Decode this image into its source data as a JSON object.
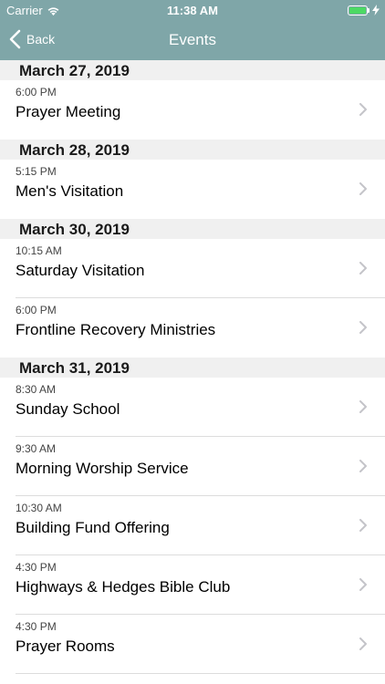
{
  "status_bar": {
    "carrier": "Carrier",
    "time": "11:38 AM"
  },
  "nav": {
    "back_label": "Back",
    "title": "Events"
  },
  "colors": {
    "header_bg": "#7fa6a8",
    "battery": "#4cd964"
  },
  "sections": [
    {
      "date": "March 27, 2019",
      "events": [
        {
          "time": "6:00 PM",
          "title": "Prayer Meeting"
        }
      ]
    },
    {
      "date": "March 28, 2019",
      "events": [
        {
          "time": "5:15 PM",
          "title": "Men's Visitation"
        }
      ]
    },
    {
      "date": "March 30, 2019",
      "events": [
        {
          "time": "10:15 AM",
          "title": "Saturday Visitation"
        },
        {
          "time": "6:00 PM",
          "title": "Frontline Recovery Ministries"
        }
      ]
    },
    {
      "date": "March 31, 2019",
      "events": [
        {
          "time": "8:30 AM",
          "title": "Sunday School"
        },
        {
          "time": "9:30 AM",
          "title": "Morning Worship Service"
        },
        {
          "time": "10:30 AM",
          "title": "Building Fund Offering"
        },
        {
          "time": "4:30 PM",
          "title": "Highways & Hedges Bible Club"
        },
        {
          "time": "4:30 PM",
          "title": "Prayer Rooms"
        }
      ]
    }
  ]
}
